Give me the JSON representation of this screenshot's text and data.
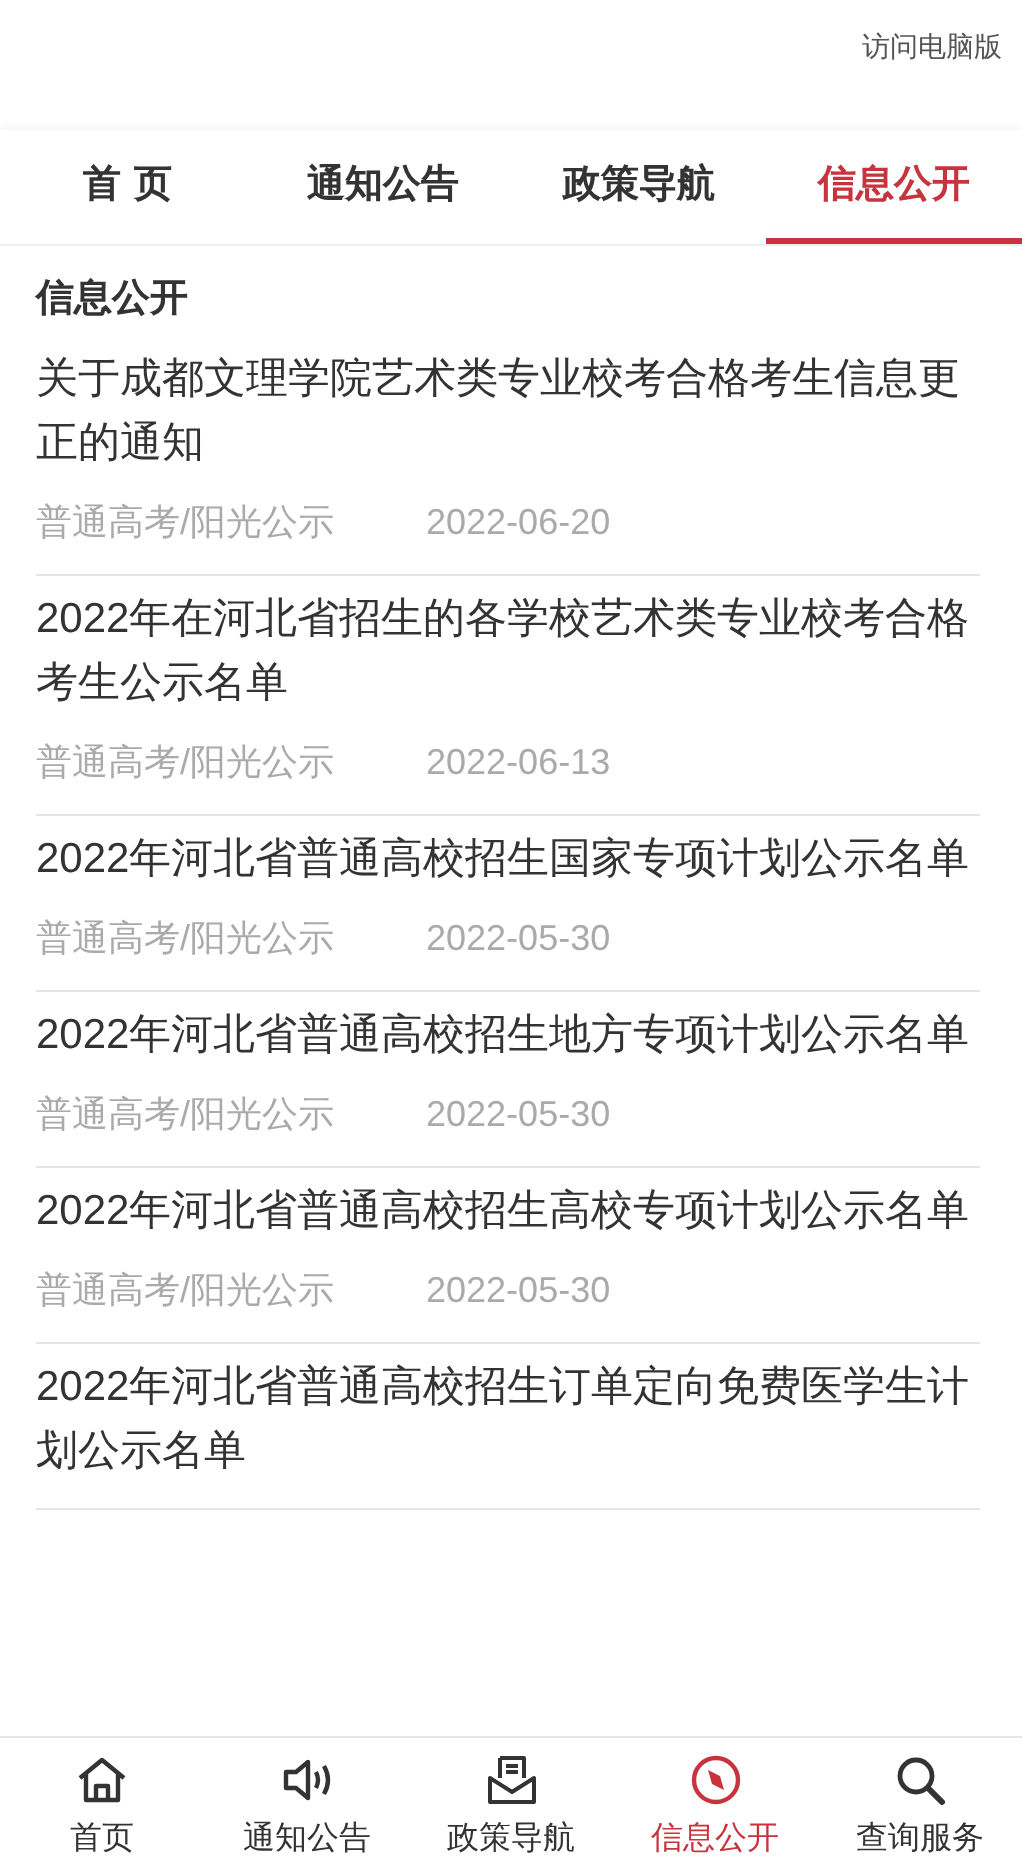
{
  "header": {
    "desktop_link": "访问电脑版"
  },
  "tabs": [
    {
      "label": "首 页",
      "selected": false
    },
    {
      "label": "通知公告",
      "selected": false
    },
    {
      "label": "政策导航",
      "selected": false
    },
    {
      "label": "信息公开",
      "selected": true
    }
  ],
  "section_title": "信息公开",
  "articles": [
    {
      "title": "关于成都文理学院艺术类专业校考合格考生信息更正的通知",
      "category": "普通高考/阳光公示",
      "date": "2022-06-20"
    },
    {
      "title": "2022年在河北省招生的各学校艺术类专业校考合格考生公示名单",
      "category": "普通高考/阳光公示",
      "date": "2022-06-13"
    },
    {
      "title": "2022年河北省普通高校招生国家专项计划公示名单",
      "category": "普通高考/阳光公示",
      "date": "2022-05-30"
    },
    {
      "title": "2022年河北省普通高校招生地方专项计划公示名单",
      "category": "普通高考/阳光公示",
      "date": "2022-05-30"
    },
    {
      "title": "2022年河北省普通高校招生高校专项计划公示名单",
      "category": "普通高考/阳光公示",
      "date": "2022-05-30"
    },
    {
      "title": "2022年河北省普通高校招生订单定向免费医学生计划公示名单"
    }
  ],
  "bottom_nav": [
    {
      "label": "首页",
      "selected": false
    },
    {
      "label": "通知公告",
      "selected": false
    },
    {
      "label": "政策导航",
      "selected": false
    },
    {
      "label": "信息公开",
      "selected": true
    },
    {
      "label": "查询服务",
      "selected": false
    }
  ]
}
